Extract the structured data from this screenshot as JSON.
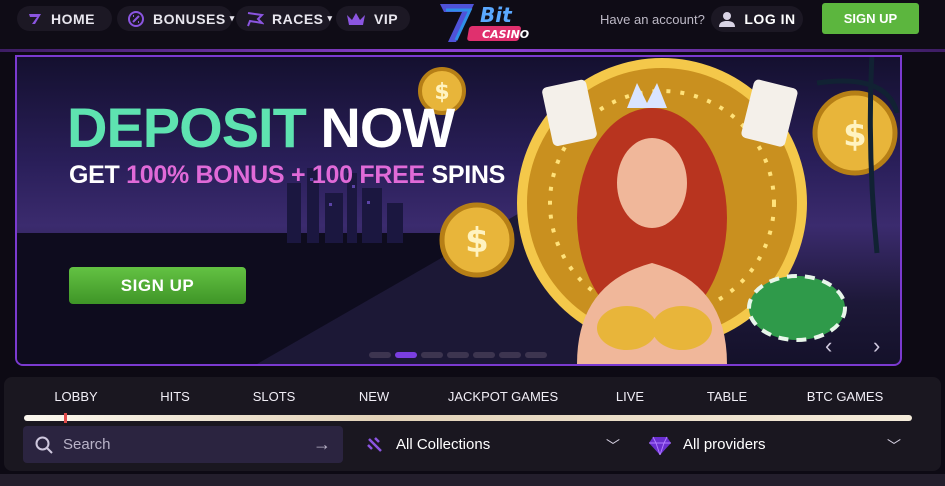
{
  "nav": {
    "home": "HOME",
    "bonuses": "BONUSES",
    "races": "RACES",
    "vip": "VIP"
  },
  "logo": {
    "text": "Bit",
    "sub": "CASINO"
  },
  "account": {
    "prompt": "Have an account?",
    "login": "LOG IN",
    "signup": "SIGN UP"
  },
  "hero": {
    "title_a": "DEPOSIT",
    "title_b": " NOW",
    "sub_a": "GET ",
    "sub_b": "100% BONUS + 100 FREE",
    "sub_c": " SPINS",
    "cta": "SIGN UP",
    "slides_total": 7,
    "slide_active": 2,
    "prev": "‹",
    "next": "›"
  },
  "tabs": [
    "LOBBY",
    "HITS",
    "SLOTS",
    "NEW",
    "JACKPOT GAMES",
    "LIVE",
    "TABLE",
    "BTC GAMES"
  ],
  "search": {
    "placeholder": "Search",
    "go": "→"
  },
  "collections": {
    "selected": "All Collections"
  },
  "providers": {
    "selected": "All providers"
  },
  "colors": {
    "accent": "#7b3ad0",
    "green": "#5cb63e",
    "mint": "#5ee3b0",
    "pink": "#e06ad8"
  }
}
